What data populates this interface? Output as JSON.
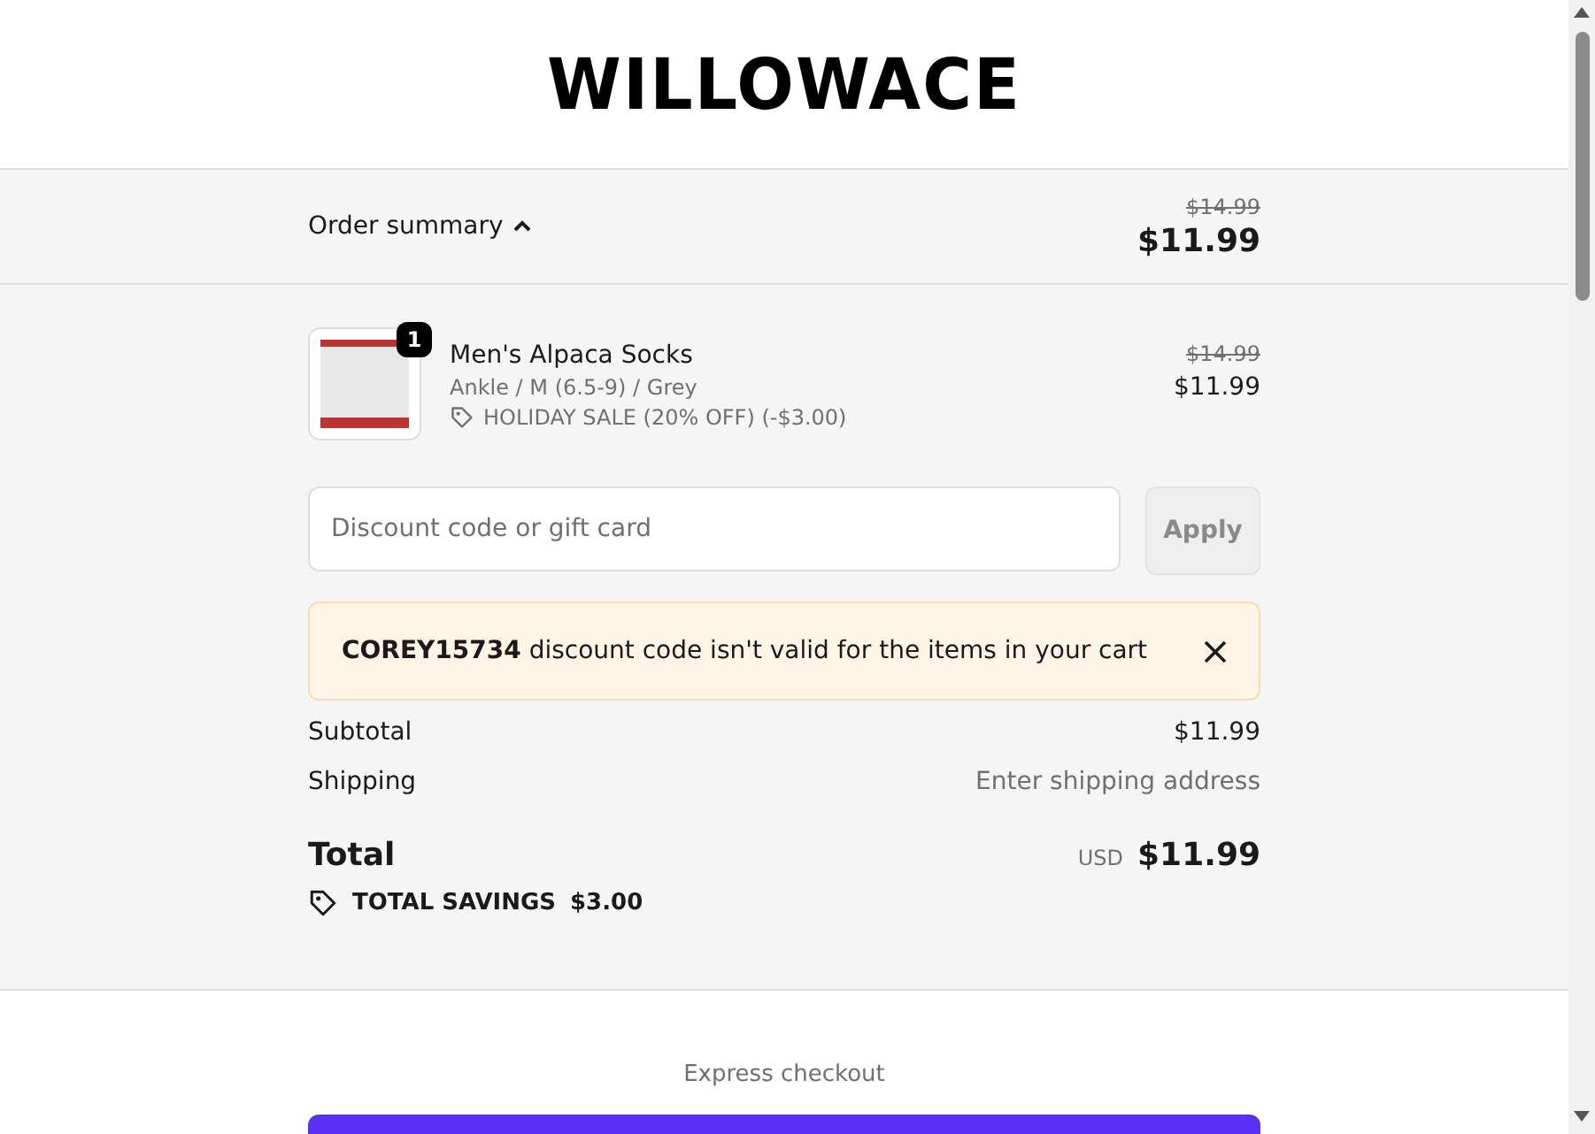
{
  "brand": {
    "logo": "WILLOWACE"
  },
  "summary_bar": {
    "label": "Order summary",
    "expanded": true,
    "original_price": "$14.99",
    "price": "$11.99"
  },
  "line_items": [
    {
      "name": "Men's Alpaca Socks",
      "variant": "Ankle / M (6.5-9) / Grey",
      "discount": "HOLIDAY SALE (20% OFF) (-$3.00)",
      "quantity": "1",
      "original_price": "$14.99",
      "price": "$11.99"
    }
  ],
  "discount_field": {
    "placeholder": "Discount code or gift card",
    "button": "Apply",
    "disabled": true
  },
  "alert": {
    "message": "**COREY15734** discount code isn't valid for the items in your cart"
  },
  "totals": [
    {
      "label": "Subtotal",
      "value": "$11.99",
      "kind": "amount"
    },
    {
      "label": "Shipping",
      "value": "Enter shipping address",
      "kind": "hint"
    }
  ],
  "total": {
    "label": "Total",
    "currency": "USD",
    "value": "$11.99",
    "savings_label": "TOTAL SAVINGS",
    "savings": "$3.00"
  },
  "express": {
    "label": "Express checkout"
  }
}
